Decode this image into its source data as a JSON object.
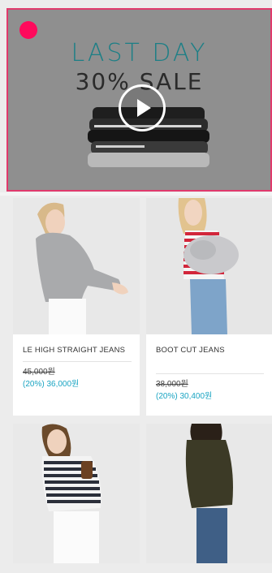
{
  "hero": {
    "title": "LAST DAY",
    "subtitle": "30% SALE",
    "accent_color": "#e03a6c",
    "dot_color": "#ff0a5c",
    "play_icon": "play-icon"
  },
  "products": [
    {
      "name": "LE HIGH STRAIGHT JEANS",
      "old_price": "45,000원",
      "sale_price": "(20%) 36,000원"
    },
    {
      "name": "BOOT CUT JEANS",
      "old_price": "38,000원",
      "sale_price": "(20%) 30,400원"
    }
  ],
  "colors": {
    "sale": "#19a4c2"
  }
}
